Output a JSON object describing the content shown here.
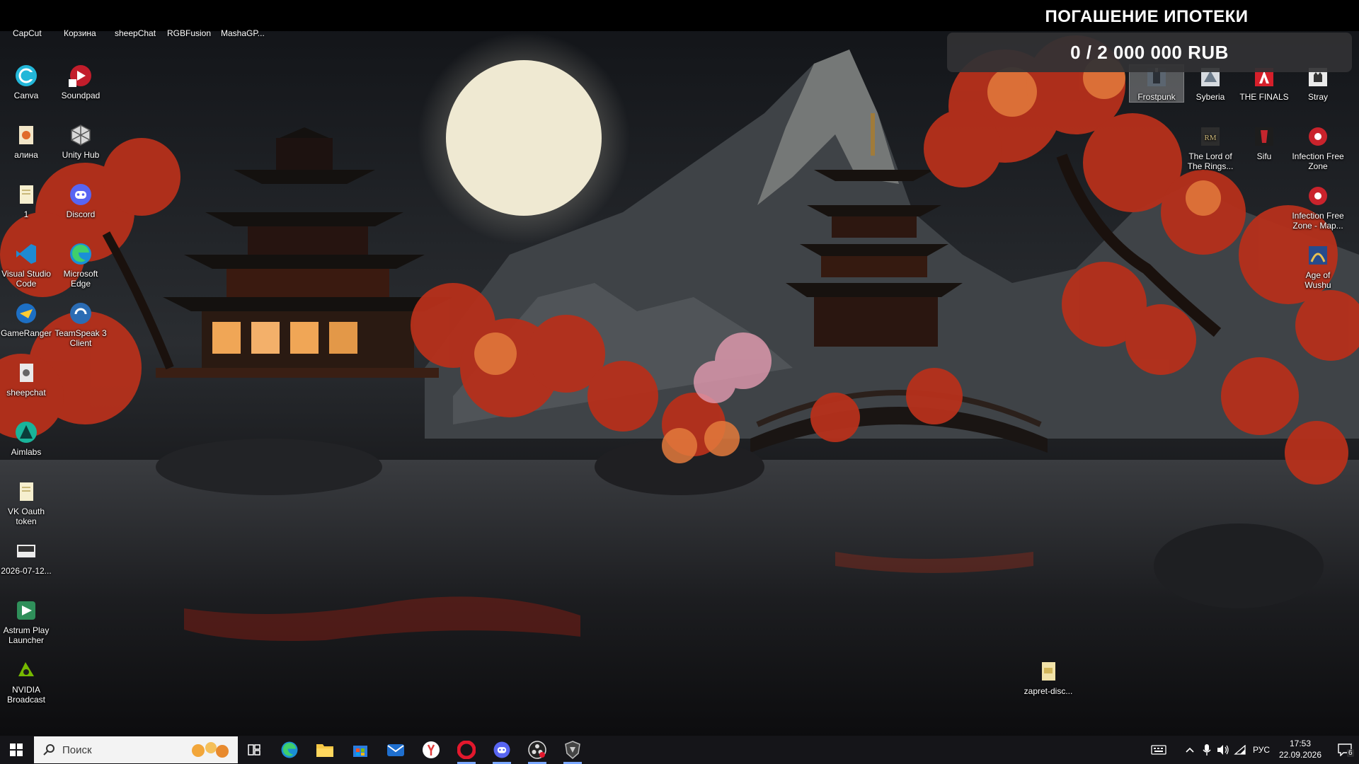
{
  "overlay": {
    "goal_title": "ПОГАШЕНИЕ ИПОТЕКИ",
    "goal_value": "0 / 2 000 000 RUB"
  },
  "desktop": {
    "top_row": [
      "CapCut",
      "Корзина",
      "sheepChat",
      "RGBFusion",
      "MashaGP..."
    ],
    "left_col1": [
      "Canva",
      "алина",
      "1",
      "Visual Studio\nCode",
      "GameRanger",
      "sheepchat",
      "Aimlabs",
      "VK Oauth\ntoken",
      "2026-07-12...",
      "Astrum Play\nLauncher",
      "NVIDIA\nBroadcast"
    ],
    "left_col2": [
      "Soundpad",
      "Unity Hub",
      "Discord",
      "Microsoft\nEdge",
      "TeamSpeak 3\nClient"
    ],
    "right_row1": [
      "Frostpunk",
      "Syberia",
      "THE FINALS",
      "Stray"
    ],
    "right_col": [
      "The Lord of\nThe Rings...",
      "Sifu",
      "Infection Free\nZone",
      "Infection Free\nZone - Map...",
      "Age of\nWushu"
    ],
    "file": "zapret-disc..."
  },
  "taskbar": {
    "search_placeholder": "Поиск",
    "language": "РУС",
    "time": "17:53",
    "date": "22.09.2026",
    "notification_count": "6"
  },
  "colors": {
    "accent": "#7aa7ff",
    "leaf_red": "#c2321c",
    "moon": "#f1ecd6"
  }
}
